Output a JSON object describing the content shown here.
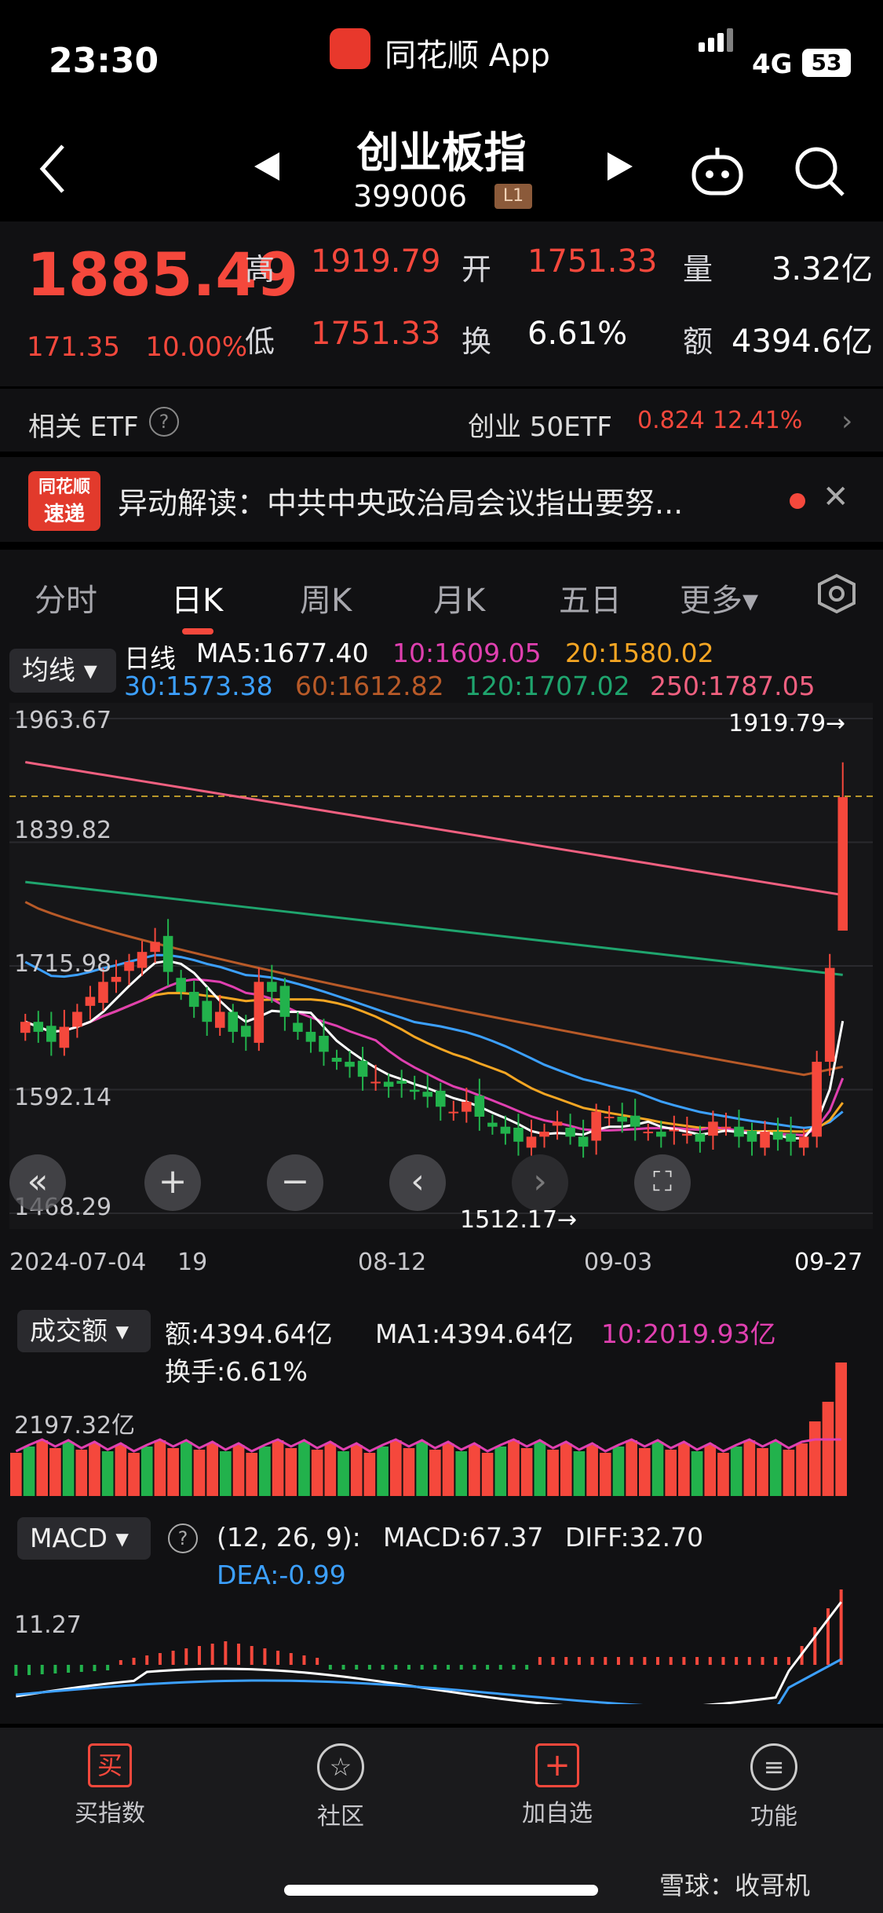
{
  "status_bar": {
    "time": "23:30",
    "app_name": "同花顺 App",
    "network": "4G",
    "battery": "53"
  },
  "nav": {
    "title": "创业板指",
    "code": "399006",
    "level": "L1"
  },
  "quote": {
    "price": "1885.49",
    "change_abs": "171.35",
    "change_pct": "10.00%",
    "fields": [
      {
        "label": "高",
        "value": "1919.79",
        "color": "red"
      },
      {
        "label": "开",
        "value": "1751.33",
        "color": "red"
      },
      {
        "label": "量",
        "value": "3.32亿",
        "color": "white"
      },
      {
        "label": "低",
        "value": "1751.33",
        "color": "red"
      },
      {
        "label": "换",
        "value": "6.61%",
        "color": "white"
      },
      {
        "label": "额",
        "value": "4394.6亿",
        "color": "white"
      }
    ]
  },
  "etf": {
    "label": "相关 ETF",
    "help": "?",
    "name": "创业 50ETF",
    "price": "0.824",
    "pct": "12.41%"
  },
  "news": {
    "logo_top": "同花顺",
    "logo_bottom": "速递",
    "text": "异动解读：中共中央政治局会议指出要努..."
  },
  "tabs": [
    "分时",
    "日K",
    "周K",
    "月K",
    "五日",
    "更多▾"
  ],
  "ma": {
    "button": "均线",
    "line1": [
      {
        "text": "日线",
        "color": "#ffffff"
      },
      {
        "text": "MA5:1677.40",
        "color": "#ffffff"
      },
      {
        "text": "10:1609.05",
        "color": "#e040b0"
      },
      {
        "text": "20:1580.02",
        "color": "#f5a623"
      }
    ],
    "line2": [
      {
        "text": "30:1573.38",
        "color": "#3ca0ff"
      },
      {
        "text": "60:1612.82",
        "color": "#b85a28"
      },
      {
        "text": "120:1707.02",
        "color": "#1fa56e"
      },
      {
        "text": "250:1787.05",
        "color": "#f06080"
      }
    ]
  },
  "kchart": {
    "y_labels": [
      "1963.67",
      "1839.82",
      "1715.98",
      "1592.14",
      "1468.29"
    ],
    "high_marker": "1919.79→",
    "low_marker": "1512.17→",
    "x_labels": [
      "2024-07-04",
      "19",
      "08-12",
      "09-03",
      "09-27"
    ]
  },
  "chart_data": {
    "type": "candlestick",
    "title": "创业板指 日K",
    "ylim": [
      1468.29,
      1963.67
    ],
    "x_ticks": [
      "2024-07-04",
      "19",
      "08-12",
      "09-03",
      "09-27"
    ],
    "last": {
      "open": 1751.33,
      "high": 1919.79,
      "low": 1751.33,
      "close": 1885.49
    },
    "ma": {
      "MA5": 1677.4,
      "MA10": 1609.05,
      "MA20": 1580.02,
      "MA30": 1573.38,
      "MA60": 1612.82,
      "MA120": 1707.02,
      "MA250": 1787.05
    },
    "closes": [
      1660,
      1650,
      1640,
      1655,
      1670,
      1685,
      1700,
      1705,
      1720,
      1730,
      1740,
      1710,
      1690,
      1675,
      1660,
      1670,
      1650,
      1645,
      1700,
      1690,
      1665,
      1650,
      1640,
      1630,
      1620,
      1615,
      1605,
      1600,
      1595,
      1598,
      1590,
      1585,
      1575,
      1570,
      1580,
      1565,
      1555,
      1548,
      1540,
      1545,
      1550,
      1560,
      1545,
      1535,
      1570,
      1565,
      1560,
      1555,
      1550,
      1545,
      1552,
      1548,
      1540,
      1560,
      1555,
      1545,
      1540,
      1550,
      1542,
      1540,
      1545,
      1620,
      1714,
      1885
    ]
  },
  "volume": {
    "button": "成交额",
    "amount": "额:4394.64亿",
    "ma1": "MA1:4394.64亿",
    "ma10": "10:2019.93亿",
    "turnover": "换手:6.61%",
    "y_label": "2197.32亿"
  },
  "macd": {
    "button": "MACD",
    "help": "?",
    "params": "(12, 26, 9):",
    "macd": "MACD:67.37",
    "diff": "DIFF:32.70",
    "dea": "DEA:-0.99",
    "y_label": "11.27"
  },
  "bottom_nav": [
    {
      "label": "买指数",
      "icon": "买"
    },
    {
      "label": "社区",
      "icon": "☆"
    },
    {
      "label": "加自选",
      "icon": "+"
    },
    {
      "label": "功能",
      "icon": "≡"
    }
  ],
  "watermark": "雪球：收哥机",
  "colors": {
    "up": "#f5483c",
    "down": "#22b24c",
    "bg": "#111113"
  }
}
